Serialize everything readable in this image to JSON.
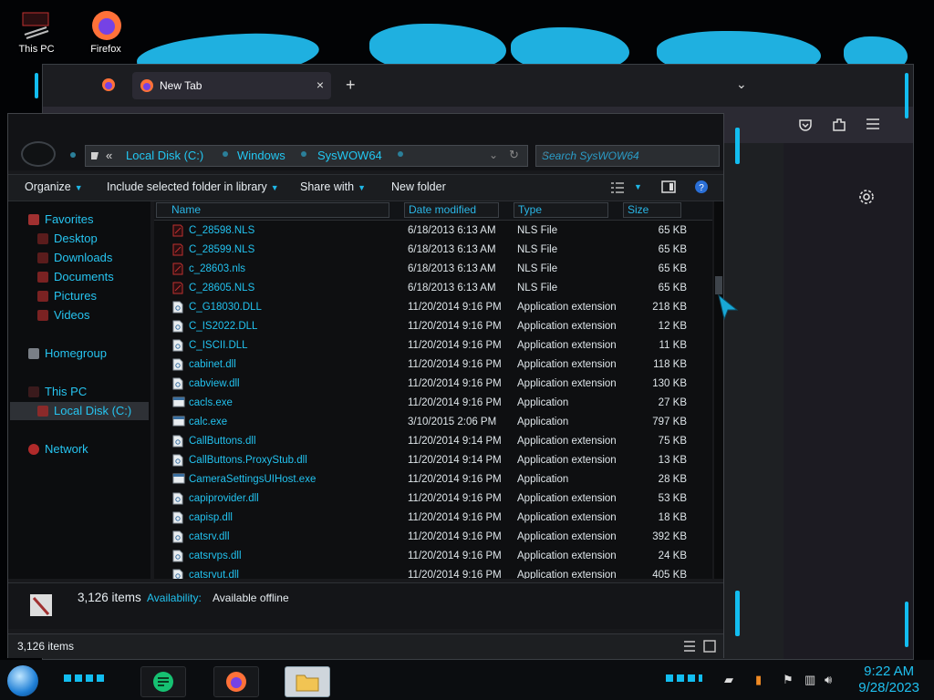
{
  "desktop": {
    "icons": [
      {
        "label": "This PC",
        "icon": "this-pc-icon"
      },
      {
        "label": "Firefox",
        "icon": "firefox-icon"
      }
    ]
  },
  "firefox": {
    "tab_title": "New Tab",
    "tab_close": "×",
    "new_tab": "+",
    "list_tabs": "⌄",
    "toolbar_icons": [
      "pocket-icon",
      "extensions-icon",
      "menu-icon",
      "settings-icon"
    ]
  },
  "explorer": {
    "address": {
      "prefix": "«",
      "crumbs": [
        "Local Disk (C:)",
        "Windows",
        "SysWOW64"
      ]
    },
    "search_placeholder": "Search SysWOW64",
    "toolbar": {
      "organize": "Organize",
      "include": "Include selected folder in library",
      "share": "Share with",
      "new_folder": "New folder"
    },
    "nav": {
      "favorites": "Favorites",
      "desktop": "Desktop",
      "downloads": "Downloads",
      "documents": "Documents",
      "pictures": "Pictures",
      "videos": "Videos",
      "homegroup": "Homegroup",
      "this_pc": "This PC",
      "local_disk": "Local Disk (C:)",
      "network": "Network"
    },
    "columns": {
      "name": "Name",
      "date": "Date modified",
      "type": "Type",
      "size": "Size"
    },
    "files": [
      {
        "name": "C_28598.NLS",
        "date": "6/18/2013 6:13 AM",
        "type": "NLS File",
        "size": "65 KB",
        "kind": "nls"
      },
      {
        "name": "C_28599.NLS",
        "date": "6/18/2013 6:13 AM",
        "type": "NLS File",
        "size": "65 KB",
        "kind": "nls"
      },
      {
        "name": "c_28603.nls",
        "date": "6/18/2013 6:13 AM",
        "type": "NLS File",
        "size": "65 KB",
        "kind": "nls"
      },
      {
        "name": "C_28605.NLS",
        "date": "6/18/2013 6:13 AM",
        "type": "NLS File",
        "size": "65 KB",
        "kind": "nls"
      },
      {
        "name": "C_G18030.DLL",
        "date": "11/20/2014 9:16 PM",
        "type": "Application extension",
        "size": "218 KB",
        "kind": "dll"
      },
      {
        "name": "C_IS2022.DLL",
        "date": "11/20/2014 9:16 PM",
        "type": "Application extension",
        "size": "12 KB",
        "kind": "dll"
      },
      {
        "name": "C_ISCII.DLL",
        "date": "11/20/2014 9:16 PM",
        "type": "Application extension",
        "size": "11 KB",
        "kind": "dll"
      },
      {
        "name": "cabinet.dll",
        "date": "11/20/2014 9:16 PM",
        "type": "Application extension",
        "size": "118 KB",
        "kind": "dll"
      },
      {
        "name": "cabview.dll",
        "date": "11/20/2014 9:16 PM",
        "type": "Application extension",
        "size": "130 KB",
        "kind": "dll"
      },
      {
        "name": "cacls.exe",
        "date": "11/20/2014 9:16 PM",
        "type": "Application",
        "size": "27 KB",
        "kind": "exe"
      },
      {
        "name": "calc.exe",
        "date": "3/10/2015 2:06 PM",
        "type": "Application",
        "size": "797 KB",
        "kind": "exe"
      },
      {
        "name": "CallButtons.dll",
        "date": "11/20/2014 9:14 PM",
        "type": "Application extension",
        "size": "75 KB",
        "kind": "dll"
      },
      {
        "name": "CallButtons.ProxyStub.dll",
        "date": "11/20/2014 9:14 PM",
        "type": "Application extension",
        "size": "13 KB",
        "kind": "dll"
      },
      {
        "name": "CameraSettingsUIHost.exe",
        "date": "11/20/2014 9:16 PM",
        "type": "Application",
        "size": "28 KB",
        "kind": "exe"
      },
      {
        "name": "capiprovider.dll",
        "date": "11/20/2014 9:16 PM",
        "type": "Application extension",
        "size": "53 KB",
        "kind": "dll"
      },
      {
        "name": "capisp.dll",
        "date": "11/20/2014 9:16 PM",
        "type": "Application extension",
        "size": "18 KB",
        "kind": "dll"
      },
      {
        "name": "catsrv.dll",
        "date": "11/20/2014 9:16 PM",
        "type": "Application extension",
        "size": "392 KB",
        "kind": "dll"
      },
      {
        "name": "catsrvps.dll",
        "date": "11/20/2014 9:16 PM",
        "type": "Application extension",
        "size": "24 KB",
        "kind": "dll"
      },
      {
        "name": "catsrvut.dll",
        "date": "11/20/2014 9:16 PM",
        "type": "Application extension",
        "size": "405 KB",
        "kind": "dll"
      }
    ],
    "details": {
      "count": "3,126 items",
      "availability_label": "Availability:",
      "availability_value": "Available offline"
    },
    "status": "3,126 items"
  },
  "taskbar": {
    "time": "9:22 AM",
    "date": "9/28/2023"
  },
  "colors": {
    "accent": "#22c2ef",
    "bg": "#0e0f11"
  }
}
